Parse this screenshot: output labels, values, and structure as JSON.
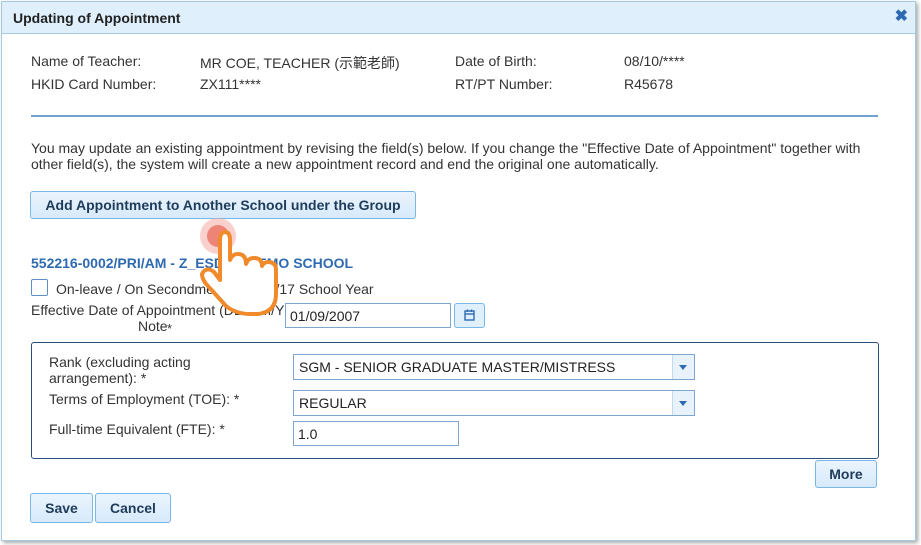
{
  "dialog": {
    "title": "Updating of Appointment",
    "close_icon": "close-icon"
  },
  "teacher": {
    "name_label": "Name of Teacher:",
    "name_value": "MR COE, TEACHER (示範老師)",
    "hkid_label": "HKID Card Number:",
    "hkid_value": "ZX111****",
    "dob_label": "Date of Birth:",
    "dob_value": "08/10/****",
    "rtpt_label": "RT/PT Number:",
    "rtpt_value": "R45678"
  },
  "instructions": "You may update an existing appointment by revising the field(s) below. If you change the \"Effective Date of Appointment\" together with other field(s), the system will create a new appointment record and end the original one automatically.",
  "add_appointment_button": "Add Appointment to Another School under the Group",
  "school_heading": "552216-0002/PRI/AM - Z_ESDAS DEMO SCHOOL",
  "onleave": {
    "label": "On-leave / On Secondment in 2016/17 School Year",
    "checked": false
  },
  "effective_date": {
    "label": "Effective Date of Appointment (DD/MM/YYYY):",
    "note": "Note",
    "required": "*",
    "value": "01/09/2007",
    "calendar_icon": "calendar-icon"
  },
  "rank": {
    "label": "Rank (excluding acting arrangement): *",
    "value": "SGM - SENIOR GRADUATE MASTER/MISTRESS"
  },
  "toe": {
    "label": "Terms of Employment (TOE):  *",
    "value": "REGULAR"
  },
  "fte": {
    "label": "Full-time Equivalent (FTE):  *",
    "value": "1.0"
  },
  "buttons": {
    "more": "More",
    "save": "Save",
    "cancel": "Cancel"
  },
  "cursor_icon": "pointing-hand-icon"
}
